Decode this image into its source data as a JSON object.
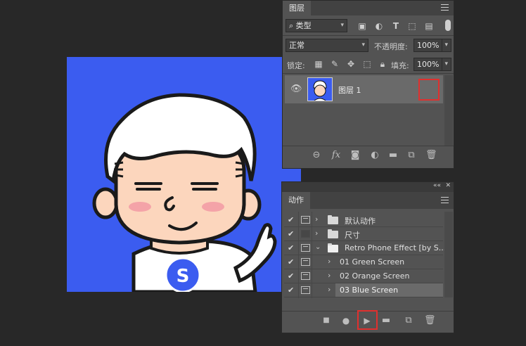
{
  "layers_panel": {
    "tab_label": "图层",
    "filter": {
      "search_icon": "⌕",
      "kind_label": "类型"
    },
    "blend_mode": "正常",
    "opacity_label": "不透明度:",
    "opacity_value": "100%",
    "lock_label": "锁定:",
    "fill_label": "填充:",
    "fill_value": "100%",
    "layers": [
      {
        "name": "图层 1",
        "visible": true
      }
    ]
  },
  "actions_panel": {
    "tab_label": "动作",
    "collapse_glyph": "««",
    "close_glyph": "✕",
    "items": [
      {
        "name": "默认动作",
        "checked": true,
        "dialog": true,
        "expanded": false,
        "kind": "set"
      },
      {
        "name": "尺寸",
        "checked": true,
        "dialog": false,
        "expanded": false,
        "kind": "set"
      },
      {
        "name": "Retro Phone Effect [by S...",
        "checked": true,
        "dialog": true,
        "expanded": true,
        "kind": "set"
      },
      {
        "name": "01 Green Screen",
        "checked": true,
        "dialog": true,
        "kind": "action"
      },
      {
        "name": "02 Orange Screen",
        "checked": true,
        "dialog": true,
        "kind": "action"
      },
      {
        "name": "03 Blue Screen",
        "checked": true,
        "dialog": true,
        "kind": "action",
        "selected": true
      }
    ]
  },
  "canvas": {
    "background_color": "#3b5cf0",
    "badge_letter": "S"
  },
  "colors": {
    "panel": "#535353",
    "dark": "#282828",
    "highlight": "#e0302e",
    "accent": "#3b5cf0"
  }
}
